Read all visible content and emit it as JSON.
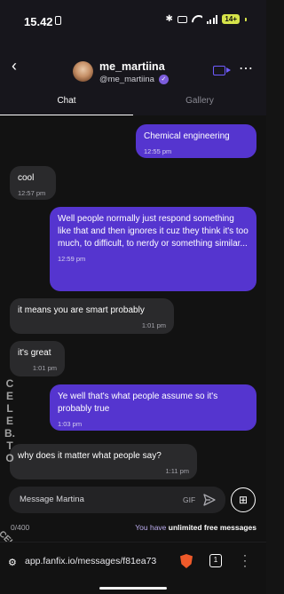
{
  "status_bar": {
    "time": "15.42",
    "battery": "14+"
  },
  "header": {
    "back_icon": "chevron-left-icon",
    "display_name": "me_martiina",
    "username": "@me_martiina",
    "verified_icon": "verified-badge-icon",
    "video_icon": "video-camera-icon",
    "more_icon": "more-horizontal-icon"
  },
  "tabs": [
    {
      "label": "Chat",
      "active": true
    },
    {
      "label": "Gallery",
      "active": false
    }
  ],
  "messages": [
    {
      "direction": "sent",
      "text": "Chemical engineering",
      "time": "12:55 pm"
    },
    {
      "direction": "received",
      "text": "cool",
      "time": "12:57 pm"
    },
    {
      "direction": "sent",
      "text": "Well people normally just respond something like that and then ignores it cuz they think it's too much, to difficult, to nerdy or something similar...",
      "time": "12:59 pm"
    },
    {
      "direction": "received",
      "text": "it means you are smart probably",
      "time": "1:01 pm"
    },
    {
      "direction": "received",
      "text": "it's great",
      "time": "1:01 pm"
    },
    {
      "direction": "sent",
      "text": "Ye well that's what people assume so it's probably true",
      "time": "1:03 pm"
    },
    {
      "direction": "received",
      "text": "why does it matter what people say?",
      "time": "1:11 pm"
    }
  ],
  "watermark": {
    "side_text": "CELEB.TO",
    "bottom_text": "CELEB.TO"
  },
  "composer": {
    "placeholder": "Message Martina",
    "gif_label": "GIF",
    "send_icon": "send-icon",
    "gift_icon": "gift-icon",
    "char_count": "0/400",
    "free_prefix": "You have",
    "free_bold": "unlimited free messages"
  },
  "browser": {
    "url": "app.fanfix.io/messages/f81ea73",
    "tab_count": "1",
    "tune_icon": "tune-icon",
    "brave_icon": "brave-shield-icon",
    "menu_icon": "more-vertical-icon"
  },
  "colors": {
    "sent_bubble": "#5535cf",
    "received_bubble": "#2a2a2c",
    "accent": "#6f5bff",
    "background": "#121212"
  }
}
